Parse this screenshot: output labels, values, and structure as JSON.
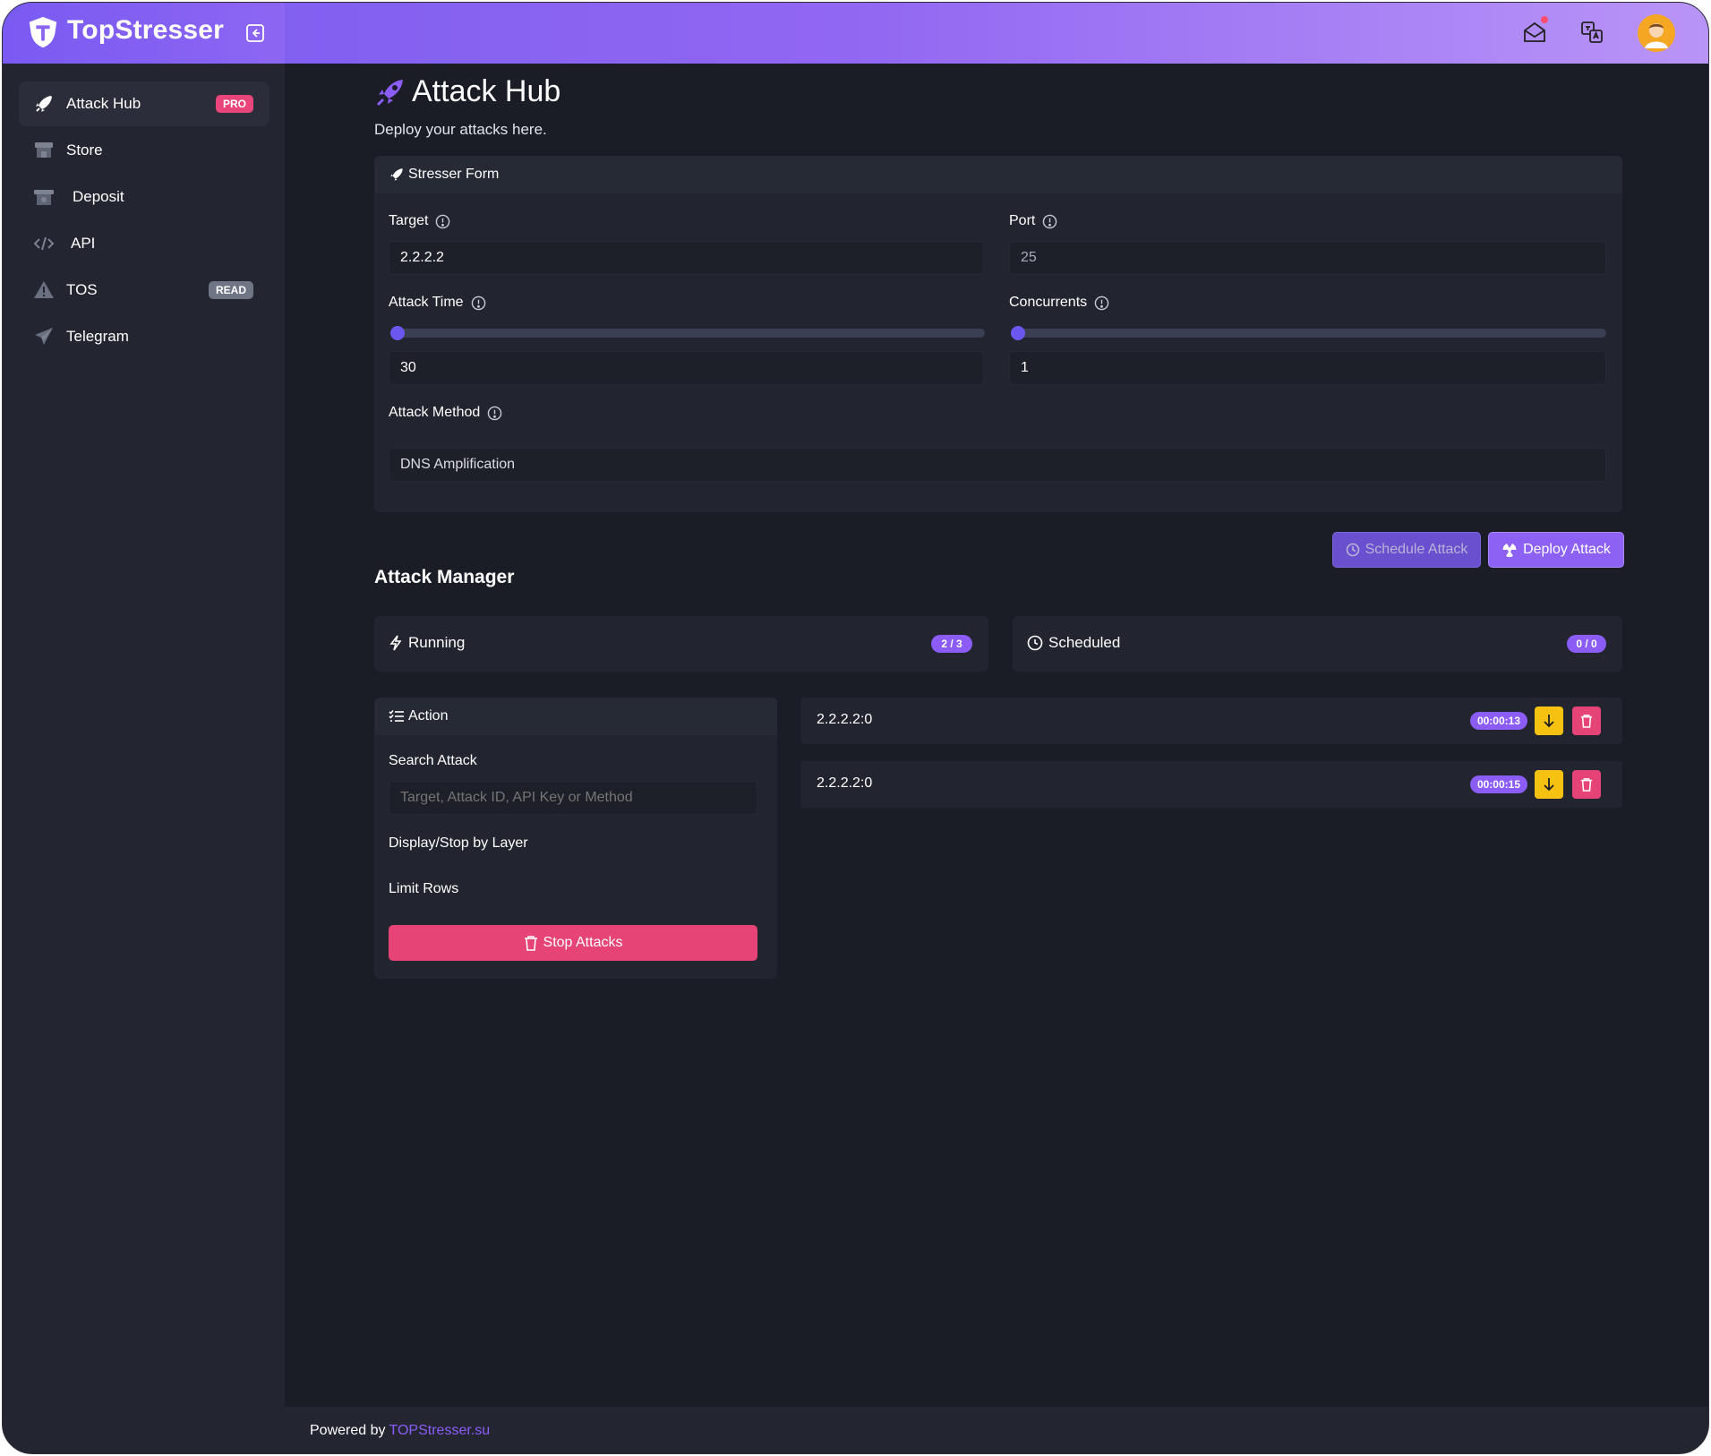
{
  "app": {
    "name": "TopStresser"
  },
  "header": {
    "icons": [
      "mail-icon",
      "translate-icon",
      "avatar"
    ]
  },
  "sidebar": {
    "items": [
      {
        "label": "Attack Hub",
        "icon": "rocket-icon",
        "badge": "PRO",
        "active": true
      },
      {
        "label": "Store",
        "icon": "store-icon"
      },
      {
        "label": "Deposit",
        "icon": "deposit-icon"
      },
      {
        "label": "API",
        "icon": "code-icon"
      },
      {
        "label": "TOS",
        "icon": "warning-icon",
        "badge": "READ"
      },
      {
        "label": "Telegram",
        "icon": "send-icon"
      }
    ]
  },
  "page": {
    "title": "Attack Hub",
    "subtitle": "Deploy your attacks here."
  },
  "form": {
    "title": "Stresser Form",
    "target_label": "Target",
    "target_value": "2.2.2.2",
    "port_label": "Port",
    "port_value": "25",
    "time_label": "Attack Time",
    "time_value": "30",
    "concurrents_label": "Concurrents",
    "concurrents_value": "1",
    "method_label": "Attack Method",
    "method_value": "DNS Amplification",
    "schedule_label": "Schedule Attack",
    "deploy_label": "Deploy Attack"
  },
  "manager": {
    "title": "Attack Manager",
    "running_label": "Running",
    "running_count": "2 / 3",
    "scheduled_label": "Scheduled",
    "scheduled_count": "0 / 0"
  },
  "action": {
    "title": "Action",
    "search_label": "Search Attack",
    "search_placeholder": "Target, Attack ID, API Key or Method",
    "layer_label": "Display/Stop by Layer",
    "limit_label": "Limit Rows",
    "stop_label": "Stop Attacks"
  },
  "attacks": [
    {
      "target": "2.2.2.2:0",
      "timer": "00:00:13"
    },
    {
      "target": "2.2.2.2:0",
      "timer": "00:00:15"
    }
  ],
  "footer": {
    "text": "Powered by",
    "link": "TOPStresser.su"
  },
  "colors": {
    "accent": "#8b5cf6",
    "danger": "#e64377",
    "warning": "#f5c211",
    "background": "#1a1d26",
    "panel": "#22252f"
  }
}
